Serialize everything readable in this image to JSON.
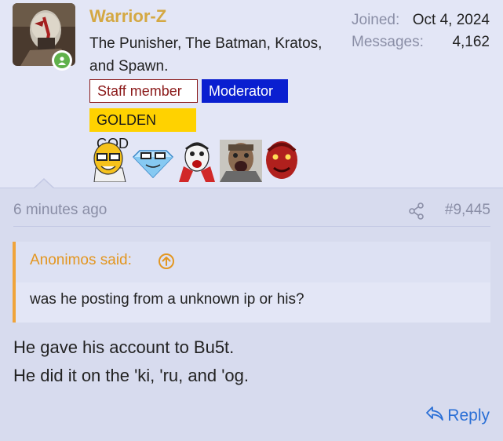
{
  "user": {
    "name": "Warrior-Z",
    "title": "The Punisher, The Batman, Kratos, and Spawn.",
    "badges": {
      "staff": "Staff member",
      "moderator": "Moderator",
      "golden": "GOLDEN GOD"
    },
    "stats": {
      "joined_label": "Joined:",
      "joined_value": "Oct 4, 2024",
      "messages_label": "Messages:",
      "messages_value": "4,162"
    },
    "online": true
  },
  "post": {
    "time": "6 minutes ago",
    "number": "#9,445",
    "quote": {
      "attribution": "Anonimos said:",
      "text": "was he posting from a unknown ip or his?"
    },
    "message_lines": [
      "He gave his account to Bu5t.",
      "He did it on the 'ki, 'ru, and 'og."
    ],
    "reply_label": "Reply"
  },
  "colors": {
    "username": "#d4a843",
    "quote_accent": "#f0a43a",
    "moderator_badge": "#0a1fd0",
    "golden_badge": "#ffd200",
    "staff_badge": "#8b1a1a",
    "link": "#2a6fd6",
    "online": "#5fb14b"
  },
  "icons": [
    "user-avatar",
    "online-status-icon",
    "soyjak-glasses-emoji",
    "diamond-emoji",
    "screaming-face-emoji",
    "screaming-man-emoji",
    "red-demon-emoji",
    "share-icon",
    "arrow-up-circle-icon",
    "reply-arrow-icon"
  ]
}
